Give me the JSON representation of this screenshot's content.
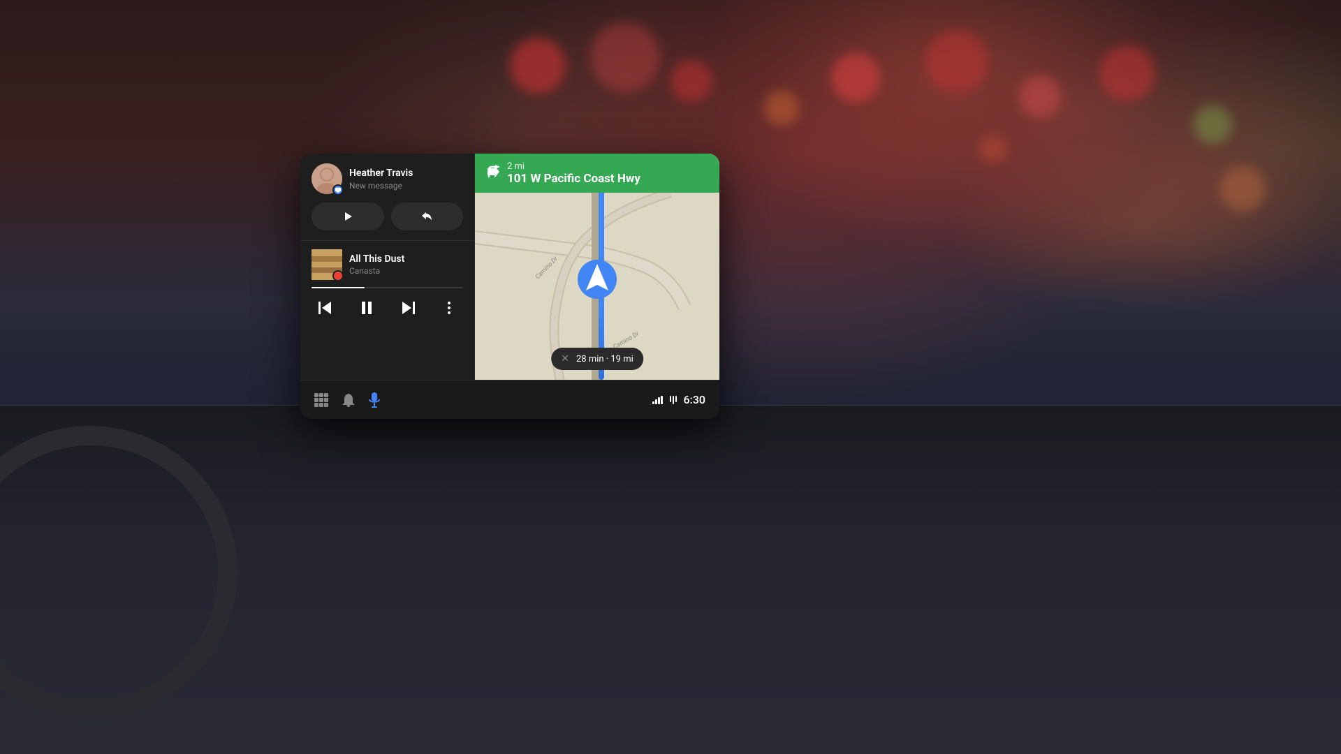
{
  "scene": {
    "background": "car interior with bokeh lights"
  },
  "android_auto": {
    "message_card": {
      "contact_name": "Heather Travis",
      "subtitle": "New message",
      "play_label": "▶",
      "reply_label": "↩"
    },
    "music_card": {
      "song_title": "All This Dust",
      "artist": "Canasta",
      "progress_percent": 35
    },
    "nav": {
      "turn_direction": "↰",
      "distance": "2 mi",
      "street": "101 W Pacific Coast Hwy",
      "eta": "28 min · 19 mi"
    },
    "bottom_bar": {
      "time": "6:30"
    }
  }
}
